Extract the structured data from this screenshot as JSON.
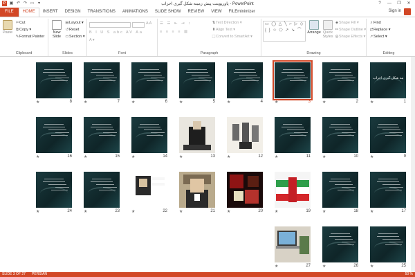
{
  "titlebar": {
    "title": "پاورپوینت پیش زمینه شکل گیری احزاب - PowerPoint",
    "minimize": "—",
    "restore": "❐",
    "close": "✕",
    "help": "?"
  },
  "tabs": [
    {
      "label": "FILE"
    },
    {
      "label": "HOME"
    },
    {
      "label": "INSERT"
    },
    {
      "label": "DESIGN"
    },
    {
      "label": "TRANSITIONS"
    },
    {
      "label": "ANIMATIONS"
    },
    {
      "label": "SLIDE SHOW"
    },
    {
      "label": "REVIEW"
    },
    {
      "label": "VIEW"
    },
    {
      "label": "FILEminimizer"
    }
  ],
  "signin": "Sign in",
  "ribbon": {
    "clipboard": {
      "paste": "Paste",
      "cut": "Cut",
      "copy": "Copy",
      "format_painter": "Format Painter",
      "label": "Clipboard"
    },
    "slides": {
      "new_slide": "New Slide",
      "layout": "Layout",
      "reset": "Reset",
      "section": "Section",
      "label": "Slides"
    },
    "font": {
      "label": "Font"
    },
    "paragraph": {
      "text_direction": "Text Direction",
      "align_text": "Align Text",
      "convert_smartart": "Convert to SmartArt",
      "label": "Paragraph"
    },
    "drawing": {
      "arrange": "Arrange",
      "quick_styles": "Quick Styles",
      "shape_fill": "Shape Fill",
      "shape_outline": "Shape Outline",
      "shape_effects": "Shape Effects",
      "label": "Drawing"
    },
    "editing": {
      "find": "Find",
      "replace": "Replace",
      "select": "Select",
      "label": "Editing"
    }
  },
  "slides": [
    {
      "num": "1",
      "title": "پیش زمینه شکل گیری احزاب",
      "style": "dark-title"
    },
    {
      "num": "2",
      "style": "dark"
    },
    {
      "num": "3",
      "style": "dark",
      "selected": true
    },
    {
      "num": "4",
      "style": "dark"
    },
    {
      "num": "5",
      "style": "dark"
    },
    {
      "num": "6",
      "style": "dark"
    },
    {
      "num": "7",
      "style": "dark"
    },
    {
      "num": "8",
      "style": "dark"
    },
    {
      "num": "9",
      "style": "dark"
    },
    {
      "num": "10",
      "style": "dark"
    },
    {
      "num": "11",
      "style": "dark"
    },
    {
      "num": "12",
      "style": "photo-group"
    },
    {
      "num": "13",
      "style": "photo-portrait"
    },
    {
      "num": "14",
      "style": "dark"
    },
    {
      "num": "15",
      "style": "dark"
    },
    {
      "num": "16",
      "style": "dark"
    },
    {
      "num": "17",
      "style": "dark"
    },
    {
      "num": "18",
      "style": "dark"
    },
    {
      "num": "19",
      "style": "photo-flag"
    },
    {
      "num": "20",
      "style": "photo-flowers"
    },
    {
      "num": "21",
      "style": "photo-man"
    },
    {
      "num": "22",
      "style": "photo-small"
    },
    {
      "num": "23",
      "style": "dark"
    },
    {
      "num": "24",
      "style": "dark"
    },
    {
      "num": "25",
      "style": "dark"
    },
    {
      "num": "26",
      "style": "dark"
    },
    {
      "num": "27",
      "style": "photo-laptop"
    }
  ],
  "status": {
    "slide_count": "SLIDE 3 OF 27",
    "language": "PERSIAN",
    "zoom": "50 %"
  },
  "colors": {
    "accent": "#d24726",
    "slide_bg": "#12292c"
  }
}
